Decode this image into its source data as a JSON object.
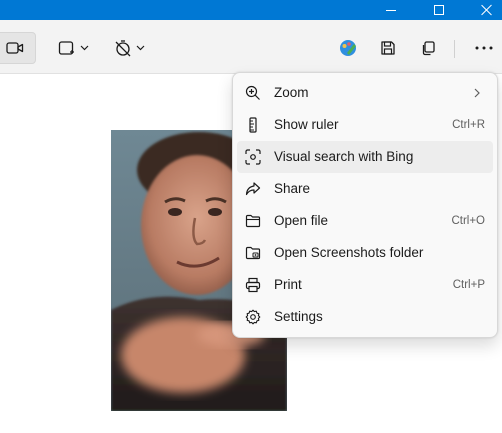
{
  "colors": {
    "titlebar": "#0078d4",
    "toolbar": "#f3f3f3",
    "menu_background": "#f9f9f9",
    "menu_hover": "#ededed",
    "accent": "#0078d4"
  },
  "window_controls": {
    "minimize_icon": "minimize-icon",
    "maximize_icon": "maximize-icon",
    "close_icon": "close-icon"
  },
  "toolbar": {
    "icons": [
      "video-icon",
      "rectangle-snip-icon",
      "chevron-down-icon",
      "timer-off-icon",
      "chevron-down-icon",
      "edit-in-paint-icon",
      "save-icon",
      "copy-icon",
      "more-options-icon"
    ]
  },
  "menu": {
    "items": [
      {
        "label": "Zoom",
        "shortcut": "",
        "icon": "zoom-icon",
        "submenu": true
      },
      {
        "label": "Show ruler",
        "shortcut": "Ctrl+R",
        "icon": "ruler-icon"
      },
      {
        "label": "Visual search with Bing",
        "shortcut": "",
        "icon": "visual-search-icon",
        "hovered": true
      },
      {
        "label": "Share",
        "shortcut": "",
        "icon": "share-icon"
      },
      {
        "label": "Open file",
        "shortcut": "Ctrl+O",
        "icon": "folder-icon"
      },
      {
        "label": "Open Screenshots folder",
        "shortcut": "",
        "icon": "screenshots-folder-icon"
      },
      {
        "label": "Print",
        "shortcut": "Ctrl+P",
        "icon": "print-icon"
      },
      {
        "label": "Settings",
        "shortcut": "",
        "icon": "gear-icon"
      }
    ]
  }
}
